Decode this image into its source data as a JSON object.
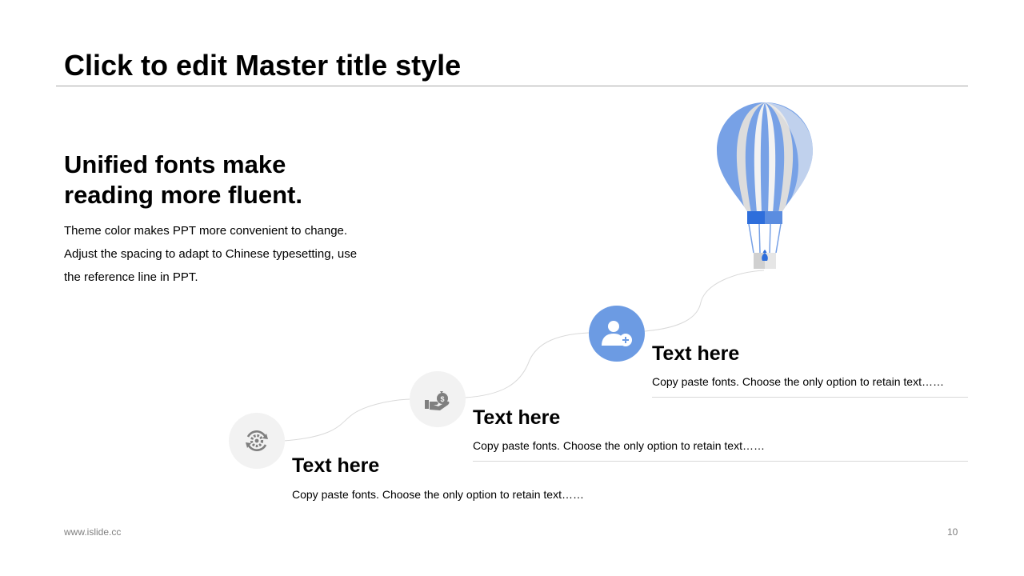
{
  "slide": {
    "title": "Click to edit Master title style",
    "page_number": "10",
    "footer_url": "www.islide.cc"
  },
  "intro": {
    "headline_line1": "Unified fonts make",
    "headline_line2": "reading more fluent.",
    "body_line1": "Theme color makes PPT more convenient to change.",
    "body_line2": "Adjust the spacing to adapt to Chinese typesetting, use",
    "body_line3": "the reference line in PPT."
  },
  "steps": [
    {
      "title": "Text here",
      "desc": "Copy paste fonts. Choose the only option to retain text……",
      "icon": "gear-refresh-icon"
    },
    {
      "title": "Text here",
      "desc": "Copy paste fonts. Choose the only option to retain text……",
      "icon": "hand-money-bag-icon"
    },
    {
      "title": "Text here",
      "desc": "Copy paste fonts. Choose the only option to retain text……",
      "icon": "user-add-icon"
    }
  ],
  "colors": {
    "accent_blue": "#6c9be3",
    "balloon_blue": "#77a1e6",
    "basket_blue": "#2e6edb",
    "stripe_gray": "#dcdcdc",
    "stripe_white": "#f2f2f2",
    "icon_gray": "#7f7f7f"
  },
  "decoration": {
    "balloon": "hot-air-balloon-icon"
  }
}
